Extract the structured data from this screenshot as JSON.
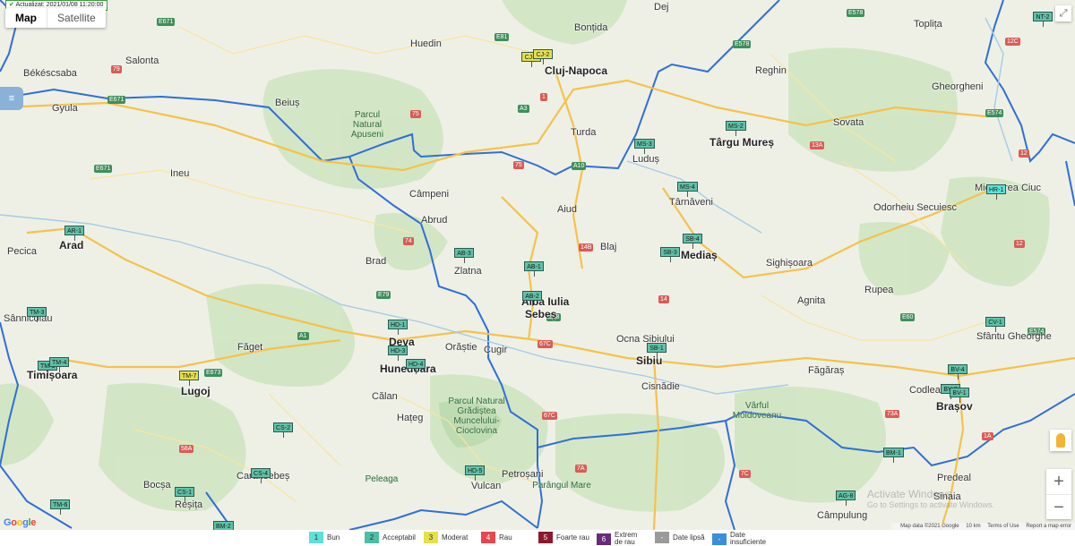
{
  "status": {
    "updated_label": "Actualizat: 2021/01/08 11:20:00"
  },
  "map_type": {
    "options": [
      "Map",
      "Satellite"
    ],
    "active": "Map"
  },
  "cities": [
    {
      "id": "cluj",
      "label": "Cluj-Napoca",
      "big": true
    },
    {
      "id": "targumures",
      "label": "Târgu Mureș",
      "big": true
    },
    {
      "id": "arad",
      "label": "Arad",
      "big": true
    },
    {
      "id": "timisoara",
      "label": "Timișoara",
      "big": true
    },
    {
      "id": "deva",
      "label": "Deva",
      "big": true
    },
    {
      "id": "hunedoara",
      "label": "Hunedoara",
      "big": true
    },
    {
      "id": "albaiulia",
      "label": "Alba Iulia",
      "big": true
    },
    {
      "id": "sebes",
      "label": "Sebeș",
      "big": true
    },
    {
      "id": "sibiu",
      "label": "Sibiu",
      "big": true
    },
    {
      "id": "medias",
      "label": "Mediaș",
      "big": true
    },
    {
      "id": "brasov",
      "label": "Brașov",
      "big": true
    },
    {
      "id": "lugoj",
      "label": "Lugoj",
      "big": true
    },
    {
      "id": "resita",
      "label": "Reșița",
      "big": false
    },
    {
      "id": "petrosani",
      "label": "Petroșani",
      "big": false
    },
    {
      "id": "fagaras",
      "label": "Făgăraș",
      "big": false
    },
    {
      "id": "sighisoara",
      "label": "Sighișoara",
      "big": false
    },
    {
      "id": "turda",
      "label": "Turda",
      "big": false
    },
    {
      "id": "huedin",
      "label": "Huedin",
      "big": false
    },
    {
      "id": "reghin",
      "label": "Reghin",
      "big": false
    },
    {
      "id": "zlatna",
      "label": "Zlatna",
      "big": false
    },
    {
      "id": "abrud",
      "label": "Abrud",
      "big": false
    },
    {
      "id": "campeni",
      "label": "Câmpeni",
      "big": false
    },
    {
      "id": "blaj",
      "label": "Blaj",
      "big": false
    },
    {
      "id": "ludus",
      "label": "Luduș",
      "big": false
    },
    {
      "id": "tarnaveni",
      "label": "Târnăveni",
      "big": false
    },
    {
      "id": "aiud",
      "label": "Aiud",
      "big": false
    },
    {
      "id": "orastie",
      "label": "Orăștie",
      "big": false
    },
    {
      "id": "hateg",
      "label": "Hațeg",
      "big": false
    },
    {
      "id": "caransebes",
      "label": "Caransebeș",
      "big": false
    },
    {
      "id": "campulung",
      "label": "Câmpulung",
      "big": false
    },
    {
      "id": "sinaia",
      "label": "Sinaia",
      "big": false
    },
    {
      "id": "gyula",
      "label": "Gyula",
      "big": false
    },
    {
      "id": "bekescsaba",
      "label": "Békéscsaba",
      "big": false
    },
    {
      "id": "salonta",
      "label": "Salonta",
      "big": false
    },
    {
      "id": "ineu",
      "label": "Ineu",
      "big": false
    },
    {
      "id": "beius",
      "label": "Beiuș",
      "big": false
    },
    {
      "id": "brad",
      "label": "Brad",
      "big": false
    },
    {
      "id": "cisnadie",
      "label": "Cisnădie",
      "big": false
    },
    {
      "id": "codlea",
      "label": "Codlea",
      "big": false
    },
    {
      "id": "odorheiu",
      "label": "Odorheiu Secuiesc",
      "big": false
    },
    {
      "id": "mierc",
      "label": "Miercurea Ciuc",
      "big": false
    },
    {
      "id": "sfantu",
      "label": "Sfântu Gheorghe",
      "big": false
    },
    {
      "id": "faget",
      "label": "Făget",
      "big": false
    },
    {
      "id": "bocsa",
      "label": "Bocșa",
      "big": false
    },
    {
      "id": "vulcan",
      "label": "Vulcan",
      "big": false
    },
    {
      "id": "agnita",
      "label": "Agnita",
      "big": false
    },
    {
      "id": "cugir",
      "label": "Cugir",
      "big": false
    },
    {
      "id": "ocnasibiului",
      "label": "Ocna Sibiului",
      "big": false
    },
    {
      "id": "gheorgheni",
      "label": "Gheorgheni",
      "big": false
    },
    {
      "id": "sovata",
      "label": "Sovata",
      "big": false
    },
    {
      "id": "bontida",
      "label": "Bonțida",
      "big": false
    },
    {
      "id": "gherla",
      "label": "Dej",
      "big": false
    },
    {
      "id": "pecica",
      "label": "Pecica",
      "big": false
    },
    {
      "id": "sannicolau",
      "label": "Sânnicolau",
      "big": false
    },
    {
      "id": "calan",
      "label": "Călan",
      "big": false
    },
    {
      "id": "rupea",
      "label": "Rupea",
      "big": false
    },
    {
      "id": "predeal",
      "label": "Predeal",
      "big": false
    },
    {
      "id": "toplita",
      "label": "Toplița",
      "big": false
    }
  ],
  "parks": [
    {
      "id": "apuseni",
      "label": "Parcul Natural Apuseni"
    },
    {
      "id": "gradistea",
      "label": "Parcul Natural Grădiștea Muncelului-Cioclovina"
    },
    {
      "id": "moldoveanu",
      "label": "Vârful Moldoveanu"
    },
    {
      "id": "parang",
      "label": "Parângul Mare"
    },
    {
      "id": "peleaga",
      "label": "Peleaga"
    }
  ],
  "stations": [
    {
      "id": "CJ-3",
      "level": 3
    },
    {
      "id": "CJ-2",
      "level": 3
    },
    {
      "id": "MS-2",
      "level": 2
    },
    {
      "id": "MS-3",
      "level": 2
    },
    {
      "id": "MS-4",
      "level": 2
    },
    {
      "id": "AR-1",
      "level": 2
    },
    {
      "id": "AB-3",
      "level": 2
    },
    {
      "id": "AB-1",
      "level": 2
    },
    {
      "id": "AB-2",
      "level": 2
    },
    {
      "id": "SB-4",
      "level": 2
    },
    {
      "id": "SB-3",
      "level": 2
    },
    {
      "id": "SB-1",
      "level": 2
    },
    {
      "id": "HR-1",
      "level": 1
    },
    {
      "id": "CV-1",
      "level": 2
    },
    {
      "id": "BV-4",
      "level": 2
    },
    {
      "id": "BV-3",
      "level": 2
    },
    {
      "id": "BV-1",
      "level": 2
    },
    {
      "id": "HD-1",
      "level": 2
    },
    {
      "id": "HD-3",
      "level": 2
    },
    {
      "id": "HD-4",
      "level": 2
    },
    {
      "id": "HD-5",
      "level": 2
    },
    {
      "id": "TM-3",
      "level": 2
    },
    {
      "id": "TM-1",
      "level": 2
    },
    {
      "id": "TM-4",
      "level": 2
    },
    {
      "id": "TM-7",
      "level": 3
    },
    {
      "id": "TM-6",
      "level": 2
    },
    {
      "id": "CS-2",
      "level": 2
    },
    {
      "id": "CS-4",
      "level": 2
    },
    {
      "id": "CS-1",
      "level": 2
    },
    {
      "id": "BM-1",
      "level": 2
    },
    {
      "id": "AG-8",
      "level": 2
    },
    {
      "id": "NT-2",
      "level": 2
    },
    {
      "id": "BM-2",
      "level": 2
    }
  ],
  "roads": [
    "E81",
    "E60",
    "E79",
    "E68",
    "E673",
    "A1",
    "A3",
    "E574",
    "E578",
    "E671",
    "A10",
    "7",
    "1",
    "13",
    "14",
    "15",
    "74",
    "79",
    "7C",
    "1C",
    "1F",
    "1R",
    "16",
    "19"
  ],
  "controls": {
    "fullscreen_icon": "fullscreen-icon",
    "pegman_icon": "pegman-icon",
    "zoom_in": "+",
    "zoom_out": "−"
  },
  "attribution": {
    "text": "Map data ©2021 Google",
    "scale": "10 km",
    "terms": "Terms of Use",
    "report": "Report a map error"
  },
  "google_logo": [
    "G",
    "o",
    "o",
    "g",
    "l",
    "e"
  ],
  "watermark": {
    "line1": "Activate Windows",
    "line2": "Go to Settings to activate Windows."
  },
  "legend": [
    {
      "num": "1",
      "label": "Bun",
      "color": "#5fe0d8"
    },
    {
      "num": "2",
      "label": "Acceptabil",
      "color": "#4dbfa2"
    },
    {
      "num": "3",
      "label": "Moderat",
      "color": "#e6e04a"
    },
    {
      "num": "4",
      "label": "Rau",
      "color": "#e5484d"
    },
    {
      "num": "5",
      "label": "Foarte rau",
      "color": "#8b1a2c"
    },
    {
      "num": "6",
      "label": "Extrem de rau",
      "color": "#6c2a7c"
    },
    {
      "num": "-",
      "label": "Date lipsă",
      "color": "#9a9a9a"
    },
    {
      "num": "-",
      "label": "Date insuficiente",
      "color": "#3a8fd8"
    }
  ],
  "colors": {
    "border": "#2f6fd6",
    "motorway": "#f7c85a",
    "forest": "#c8e2bc",
    "land": "#eef0e6"
  }
}
